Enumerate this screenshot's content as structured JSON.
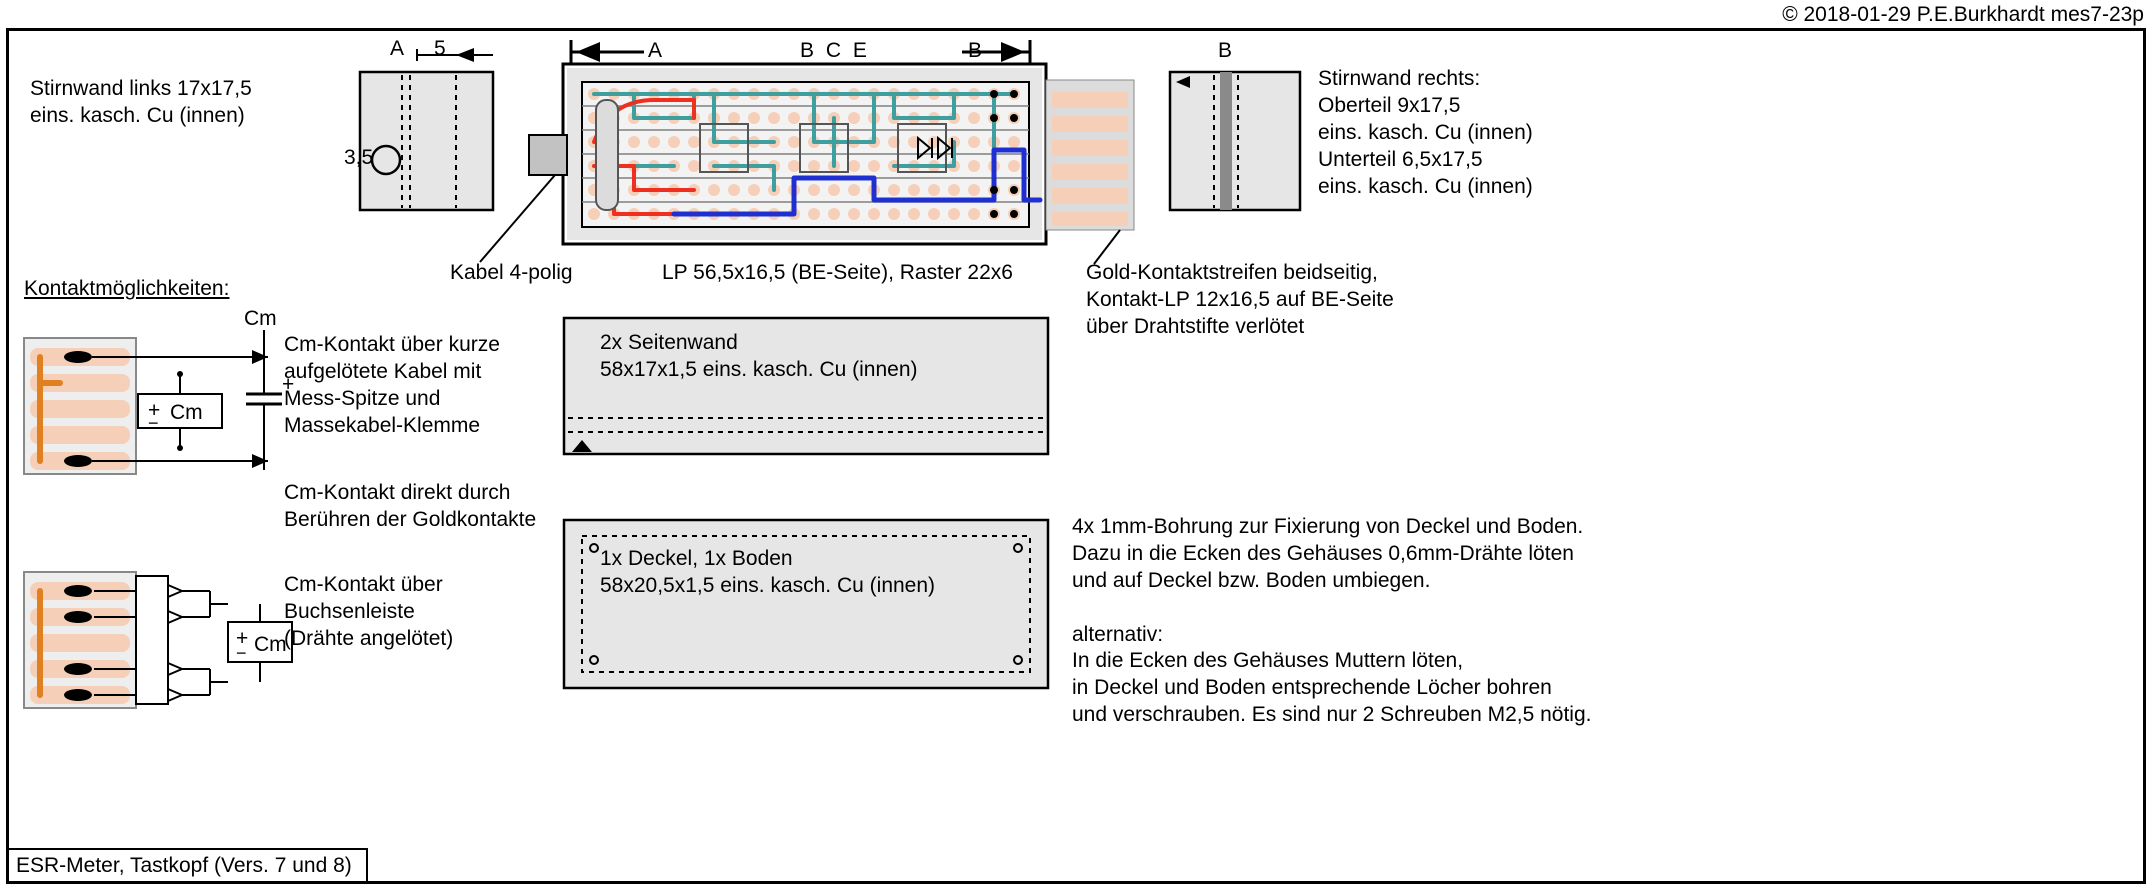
{
  "copyright": "© 2018-01-29 P.E.Burkhardt mes7-23p",
  "title": "ESR-Meter,  Tastkopf (Vers. 7 und 8)",
  "arrow_labels": {
    "A_left": "A",
    "B_right": "B",
    "BCE": "B C E",
    "B_top": "B",
    "A_topleft": "A",
    "dim5": "5",
    "dim35": "3,5"
  },
  "left_wall": {
    "l1": "Stirnwand links 17x17,5",
    "l2": "eins. kasch. Cu (innen)"
  },
  "pcb_caption": "LP 56,5x16,5 (BE-Seite), Raster 22x6",
  "cable_caption": "Kabel 4-polig",
  "side_wall": {
    "l1": "2x  Seitenwand",
    "l2": "58x17x1,5 eins. kasch. Cu (innen)"
  },
  "lid_floor": {
    "l1": "1x Deckel, 1x Boden",
    "l2": "58x20,5x1,5 eins. kasch. Cu (innen)"
  },
  "right_wall": {
    "l1": "Stirnwand rechts:",
    "l2": "Oberteil 9x17,5",
    "l3": "eins. kasch. Cu (innen)",
    "l4": "Unterteil 6,5x17,5",
    "l5": "eins. kasch. Cu (innen)"
  },
  "gold_strip": {
    "l1": "Gold-Kontaktstreifen beidseitig,",
    "l2": "Kontakt-LP 12x16,5 auf BE-Seite",
    "l3": "über Drahtstifte verlötet"
  },
  "rightnotes": {
    "l1": "4x 1mm-Bohrung zur Fixierung von Deckel und Boden.",
    "l2": "Dazu in die Ecken des Gehäuses 0,6mm-Drähte löten",
    "l3": "und auf Deckel bzw. Boden umbiegen.",
    "lalt": "alternativ:",
    "l5": "In die Ecken des Gehäuses Muttern löten,",
    "l6": "in Deckel und Boden entsprechende Löcher bohren",
    "l7": "und verschrauben. Es sind nur 2 Schreuben M2,5 nötig."
  },
  "contacts_heading": "Kontaktmöglichkeiten:",
  "cm_sym": "Cm",
  "cm_plus": "+",
  "cm_minus": "−",
  "cm_note1": {
    "l1": "Cm-Kontakt über kurze",
    "l2": "aufgelötete Kabel mit",
    "l3": "Mess-Spitze und",
    "l4": "Massekabel-Klemme"
  },
  "cm_note2": {
    "l1": "Cm-Kontakt direkt durch",
    "l2": "Berühren der Goldkontakte"
  },
  "cm_note3": {
    "l1": "Cm-Kontakt über",
    "l2": "Buchsenleiste",
    "l3": "(Drähte angelötet)"
  }
}
